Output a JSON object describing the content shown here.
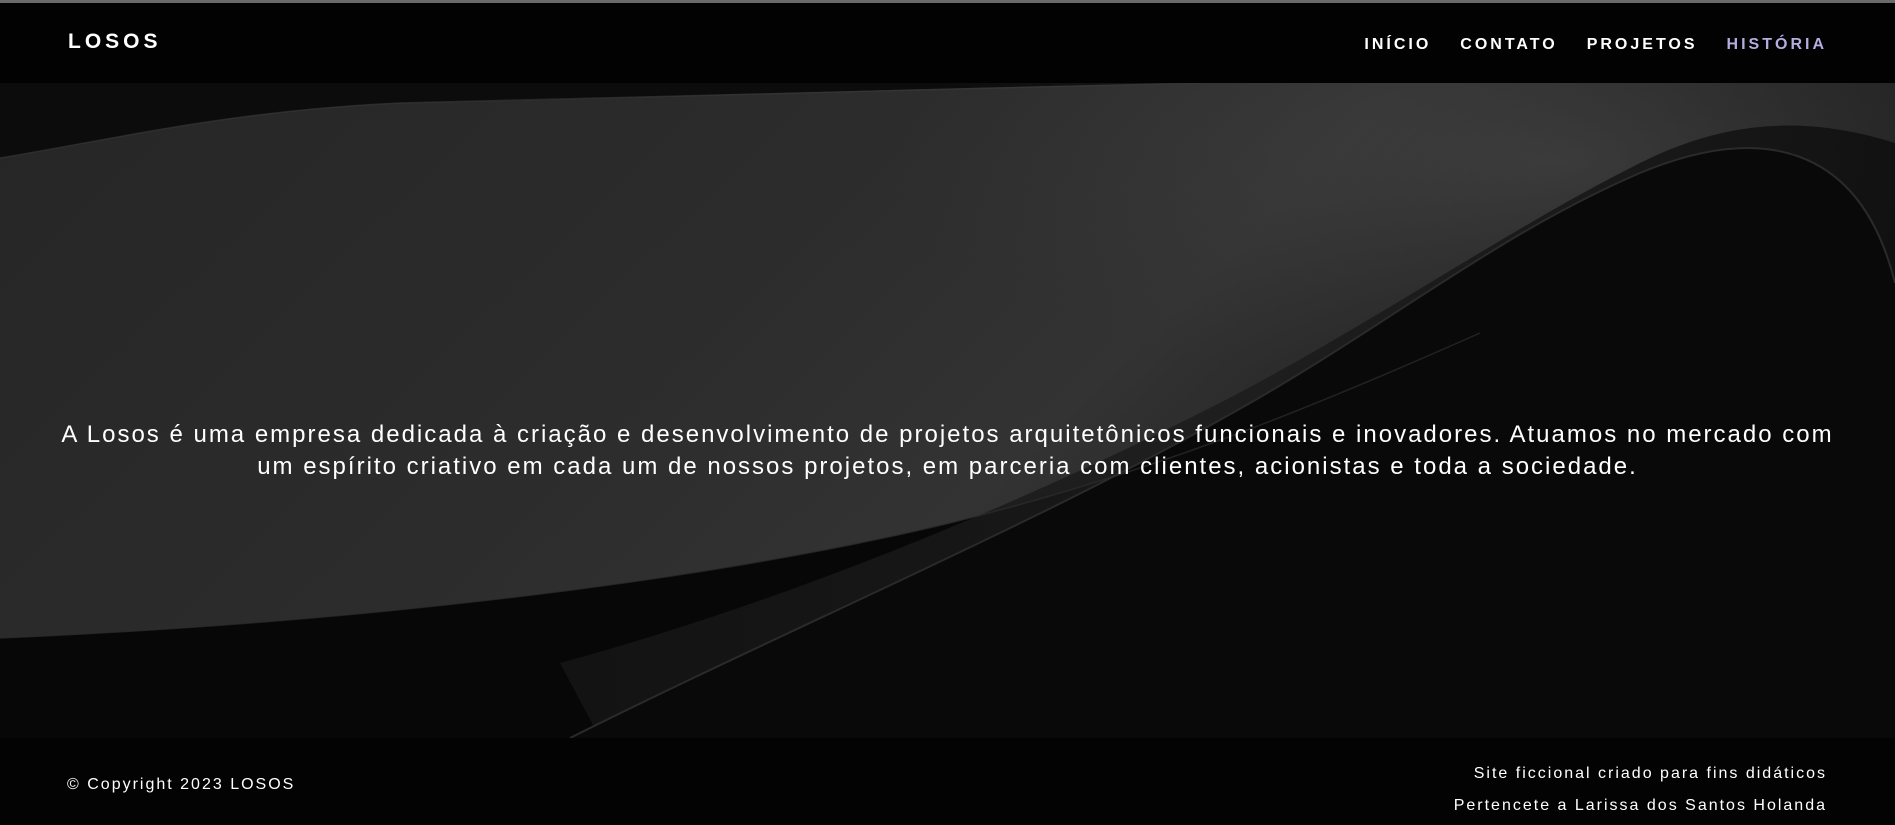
{
  "header": {
    "logo": "LOSOS",
    "nav": [
      {
        "label": "INÍCIO",
        "active": false
      },
      {
        "label": "CONTATO",
        "active": false
      },
      {
        "label": "PROJETOS",
        "active": false
      },
      {
        "label": "HISTÓRIA",
        "active": true
      }
    ],
    "active_color": "#b4aee0"
  },
  "hero": {
    "text": "A Losos é uma empresa dedicada à criação e desenvolvimento de projetos arquitetônicos funcionais e inovadores. Atuamos no mercado com um espírito criativo em cada um de nossos projetos, em parceria com clientes, acionistas e toda a sociedade."
  },
  "footer": {
    "copyright": "© Copyright 2023 LOSOS",
    "line1": "Site ficcional criado para fins didáticos",
    "line2": "Pertencete a Larissa dos Santos Holanda"
  }
}
